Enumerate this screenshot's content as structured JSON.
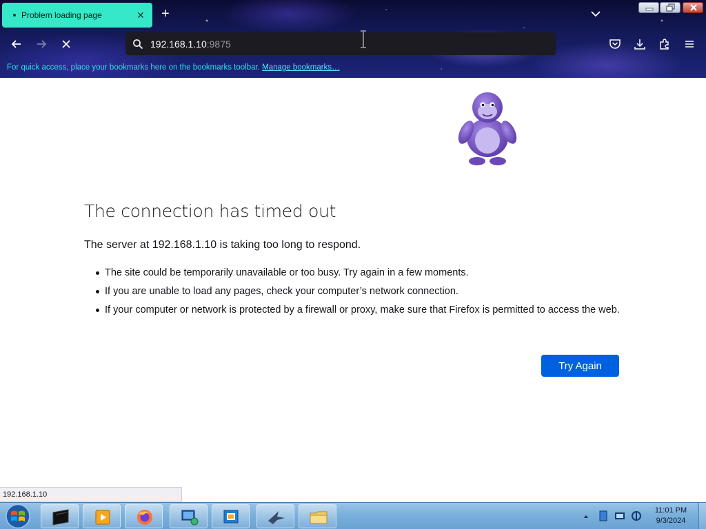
{
  "browser": {
    "tab_title": "Problem loading page",
    "url_host": "192.168.1.10",
    "url_port": ":9875",
    "bookmarks_text": "For quick access, place your bookmarks here on the bookmarks toolbar.",
    "bookmarks_link": "Manage bookmarks…"
  },
  "error": {
    "title": "The connection has timed out",
    "description": "The server at 192.168.1.10 is taking too long to respond.",
    "bullets": [
      "The site could be temporarily unavailable or too busy. Try again in a few moments.",
      "If you are unable to load any pages, check your computer’s network connection.",
      "If your computer or network is protected by a firewall or proxy, make sure that Firefox is permitted to access the web."
    ],
    "try_again": "Try Again"
  },
  "statusbar": {
    "text": "192.168.1.10"
  },
  "taskbar": {
    "time": "11:01 PM",
    "date": "9/3/2024",
    "apps": [
      "terminal",
      "media-player",
      "firefox",
      "network-explorer",
      "virtualbox",
      "pidgin",
      "file-explorer"
    ]
  },
  "colors": {
    "tab_accent": "#35e8c7",
    "primary_button": "#0061e0",
    "bookmark_text": "#29e0e4"
  }
}
